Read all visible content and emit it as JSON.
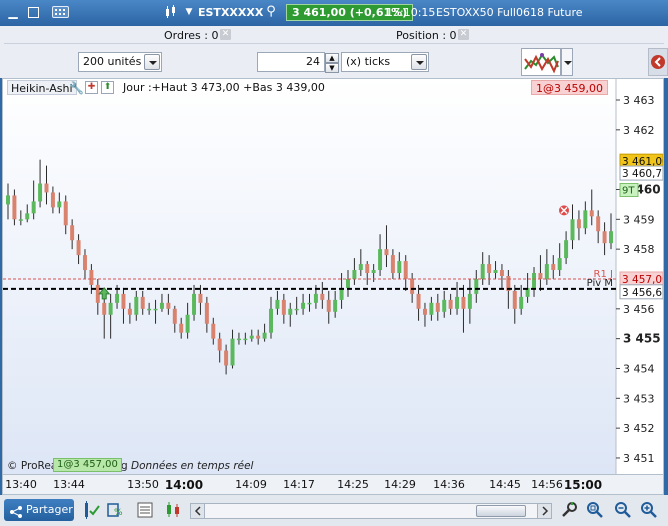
{
  "titlebar": {
    "instrument": "ESTXXXXX",
    "price_badge": "3 461,00 (+0,61%)",
    "time": "15:10:15",
    "description": "ESTOXX50 Full0618 Future"
  },
  "toolbar": {
    "orders_label": "Ordres : 0",
    "position_label": "Position : 0",
    "quantity_select": "200 unités",
    "tick_value": "24",
    "tick_unit_select": "(x) ticks"
  },
  "chart": {
    "indicator_label": "Heikin-Ashi",
    "header_stats": "Jour :+Haut 3 473,00 +Bas 3 439,00",
    "order_tag_top": "1@3 459,00",
    "order_tag_bottom": "1@3 457,00",
    "copyright": "© ProRealTime Trading",
    "copyright_note": "Données en temps réel",
    "label_r1": "R1 J",
    "label_pivot": "Piv M",
    "marker_9t": "9T",
    "price_tags": {
      "last": "3 461,00",
      "current": "3 460,75",
      "r1": "3 457,00",
      "pivot": "3 456,67"
    },
    "colors": {
      "bull": "#5cb85c",
      "bear": "#d9826e",
      "r1_line": "#d9534f",
      "pivot_line": "#000000",
      "last_tag": "#f0c419",
      "r1_tag": "#f8d2d2",
      "bg_top": "#ffffff",
      "bg_bottom": "#dde6f6"
    }
  },
  "chart_data": {
    "type": "candlestick",
    "y_ticks": [
      {
        "value": 3463,
        "label": "3 463",
        "bold": false
      },
      {
        "value": 3462,
        "label": "3 462",
        "bold": false
      },
      {
        "value": 3460,
        "label": "3 460",
        "bold": true
      },
      {
        "value": 3459,
        "label": "3 459",
        "bold": false
      },
      {
        "value": 3458,
        "label": "3 458",
        "bold": false
      },
      {
        "value": 3456,
        "label": "3 456",
        "bold": false
      },
      {
        "value": 3455,
        "label": "3 455",
        "bold": true
      },
      {
        "value": 3454,
        "label": "3 454",
        "bold": false
      },
      {
        "value": 3453,
        "label": "3 453",
        "bold": false
      },
      {
        "value": 3452,
        "label": "3 452",
        "bold": false
      },
      {
        "value": 3451,
        "label": "3 451",
        "bold": false
      }
    ],
    "ylim": [
      3450.5,
      3463.7
    ],
    "x_ticks": [
      {
        "label": "13:40",
        "bold": false
      },
      {
        "label": "13:44",
        "bold": false
      },
      {
        "label": "13:50",
        "bold": false
      },
      {
        "label": "14:00",
        "bold": true
      },
      {
        "label": "14:09",
        "bold": false
      },
      {
        "label": "14:17",
        "bold": false
      },
      {
        "label": "14:25",
        "bold": false
      },
      {
        "label": "14:29",
        "bold": false
      },
      {
        "label": "14:36",
        "bold": false
      },
      {
        "label": "14:45",
        "bold": false
      },
      {
        "label": "14:56",
        "bold": false
      },
      {
        "label": "15:00",
        "bold": true
      }
    ],
    "r1_level": 3457.0,
    "pivot_level": 3456.67,
    "buy_marker_price": 3456.5,
    "sell_marker_price": 3459.3,
    "candles": [
      [
        3459.5,
        3459.8,
        3460.2,
        3459.0
      ],
      [
        3459.8,
        3459.0,
        3460.0,
        3458.8
      ],
      [
        3459.0,
        3459.0,
        3459.3,
        3458.8
      ],
      [
        3459.0,
        3459.2,
        3459.5,
        3458.9
      ],
      [
        3459.2,
        3459.6,
        3460.3,
        3459.0
      ],
      [
        3459.6,
        3460.2,
        3461.0,
        3459.4
      ],
      [
        3460.2,
        3459.9,
        3460.8,
        3459.5
      ],
      [
        3459.9,
        3459.4,
        3460.1,
        3459.2
      ],
      [
        3459.4,
        3459.6,
        3459.9,
        3459.2
      ],
      [
        3459.6,
        3458.8,
        3459.8,
        3458.5
      ],
      [
        3458.8,
        3458.3,
        3459.0,
        3458.0
      ],
      [
        3458.3,
        3457.8,
        3458.5,
        3457.5
      ],
      [
        3457.8,
        3457.3,
        3458.0,
        3457.0
      ],
      [
        3457.3,
        3456.8,
        3457.5,
        3456.5
      ],
      [
        3456.8,
        3456.2,
        3457.0,
        3455.8
      ],
      [
        3456.2,
        3455.8,
        3456.6,
        3455.0
      ],
      [
        3455.8,
        3456.2,
        3456.5,
        3455.0
      ],
      [
        3456.2,
        3456.5,
        3456.8,
        3456.0
      ],
      [
        3456.5,
        3456.0,
        3456.7,
        3455.5
      ],
      [
        3456.0,
        3455.8,
        3456.2,
        3455.5
      ],
      [
        3455.8,
        3456.4,
        3456.6,
        3455.6
      ],
      [
        3456.4,
        3456.0,
        3456.6,
        3455.8
      ],
      [
        3456.0,
        3456.0,
        3456.2,
        3455.8
      ],
      [
        3456.0,
        3456.0,
        3456.3,
        3455.5
      ],
      [
        3456.0,
        3456.2,
        3456.5,
        3455.9
      ],
      [
        3456.2,
        3456.0,
        3456.5,
        3455.8
      ],
      [
        3456.0,
        3455.5,
        3456.1,
        3455.2
      ],
      [
        3455.5,
        3455.2,
        3455.7,
        3455.0
      ],
      [
        3455.2,
        3455.8,
        3456.2,
        3455.0
      ],
      [
        3455.8,
        3456.5,
        3456.8,
        3455.6
      ],
      [
        3456.5,
        3456.2,
        3456.8,
        3455.8
      ],
      [
        3456.2,
        3455.5,
        3456.4,
        3455.2
      ],
      [
        3455.5,
        3455.0,
        3455.7,
        3454.8
      ],
      [
        3455.0,
        3454.6,
        3455.2,
        3454.2
      ],
      [
        3454.6,
        3454.1,
        3454.8,
        3453.8
      ],
      [
        3454.1,
        3455.0,
        3455.3,
        3454.0
      ],
      [
        3455.0,
        3455.0,
        3455.2,
        3454.8
      ],
      [
        3455.0,
        3455.0,
        3455.2,
        3454.8
      ],
      [
        3455.0,
        3455.1,
        3455.3,
        3454.9
      ],
      [
        3455.1,
        3455.0,
        3455.3,
        3454.8
      ],
      [
        3455.0,
        3455.2,
        3455.5,
        3454.9
      ],
      [
        3455.2,
        3456.0,
        3456.4,
        3455.0
      ],
      [
        3456.0,
        3456.3,
        3456.6,
        3455.8
      ],
      [
        3456.3,
        3455.8,
        3456.5,
        3455.5
      ],
      [
        3455.8,
        3456.0,
        3456.2,
        3455.4
      ],
      [
        3456.0,
        3456.0,
        3456.4,
        3455.8
      ],
      [
        3456.0,
        3456.2,
        3456.5,
        3455.8
      ],
      [
        3456.2,
        3456.2,
        3456.5,
        3455.9
      ],
      [
        3456.2,
        3456.5,
        3456.8,
        3456.0
      ],
      [
        3456.5,
        3456.3,
        3456.9,
        3456.0
      ],
      [
        3456.3,
        3455.9,
        3456.6,
        3455.5
      ],
      [
        3455.9,
        3456.3,
        3456.6,
        3455.7
      ],
      [
        3456.3,
        3456.7,
        3457.2,
        3456.0
      ],
      [
        3456.7,
        3457.0,
        3457.3,
        3456.4
      ],
      [
        3457.0,
        3457.3,
        3457.7,
        3456.8
      ],
      [
        3457.3,
        3457.5,
        3458.0,
        3457.1
      ],
      [
        3457.5,
        3457.2,
        3457.6,
        3456.8
      ],
      [
        3457.2,
        3457.3,
        3457.5,
        3456.9
      ],
      [
        3457.3,
        3458.0,
        3458.5,
        3457.1
      ],
      [
        3458.0,
        3457.8,
        3458.8,
        3457.4
      ],
      [
        3457.8,
        3457.2,
        3458.0,
        3457.0
      ],
      [
        3457.2,
        3457.6,
        3457.9,
        3457.0
      ],
      [
        3457.6,
        3457.0,
        3457.8,
        3456.6
      ],
      [
        3457.0,
        3456.5,
        3457.2,
        3456.2
      ],
      [
        3456.5,
        3456.0,
        3456.8,
        3455.6
      ],
      [
        3456.0,
        3455.8,
        3456.2,
        3455.4
      ],
      [
        3455.8,
        3456.2,
        3456.4,
        3455.6
      ],
      [
        3456.2,
        3455.9,
        3456.5,
        3455.6
      ],
      [
        3455.9,
        3456.3,
        3456.6,
        3455.7
      ],
      [
        3456.3,
        3456.0,
        3456.5,
        3455.8
      ],
      [
        3456.0,
        3456.4,
        3456.9,
        3455.8
      ],
      [
        3456.4,
        3456.0,
        3456.8,
        3455.2
      ],
      [
        3456.0,
        3456.5,
        3457.0,
        3455.5
      ],
      [
        3456.5,
        3457.0,
        3457.3,
        3456.2
      ],
      [
        3457.0,
        3457.5,
        3457.9,
        3456.8
      ],
      [
        3457.5,
        3457.2,
        3457.8,
        3456.8
      ],
      [
        3457.2,
        3457.3,
        3457.6,
        3457.0
      ],
      [
        3457.3,
        3457.1,
        3457.5,
        3456.7
      ],
      [
        3457.1,
        3456.6,
        3457.3,
        3456.0
      ],
      [
        3456.6,
        3456.0,
        3456.8,
        3455.5
      ],
      [
        3456.0,
        3456.4,
        3456.8,
        3455.8
      ],
      [
        3456.4,
        3456.7,
        3457.2,
        3456.2
      ],
      [
        3456.7,
        3457.2,
        3457.4,
        3456.4
      ],
      [
        3457.2,
        3457.0,
        3457.8,
        3456.6
      ],
      [
        3457.0,
        3457.5,
        3458.0,
        3456.8
      ],
      [
        3457.5,
        3457.3,
        3457.8,
        3457.0
      ],
      [
        3457.3,
        3457.7,
        3458.2,
        3457.1
      ],
      [
        3457.7,
        3458.3,
        3458.6,
        3457.5
      ],
      [
        3458.3,
        3459.0,
        3459.5,
        3458.0
      ],
      [
        3459.0,
        3458.7,
        3459.3,
        3458.3
      ],
      [
        3458.7,
        3459.3,
        3459.6,
        3458.5
      ],
      [
        3459.3,
        3459.1,
        3460.0,
        3458.8
      ],
      [
        3459.1,
        3458.6,
        3459.3,
        3458.2
      ],
      [
        3458.6,
        3458.2,
        3458.9,
        3457.8
      ],
      [
        3458.2,
        3458.6,
        3459.2,
        3458.0
      ]
    ]
  },
  "bottom": {
    "share_label": "Partager"
  }
}
